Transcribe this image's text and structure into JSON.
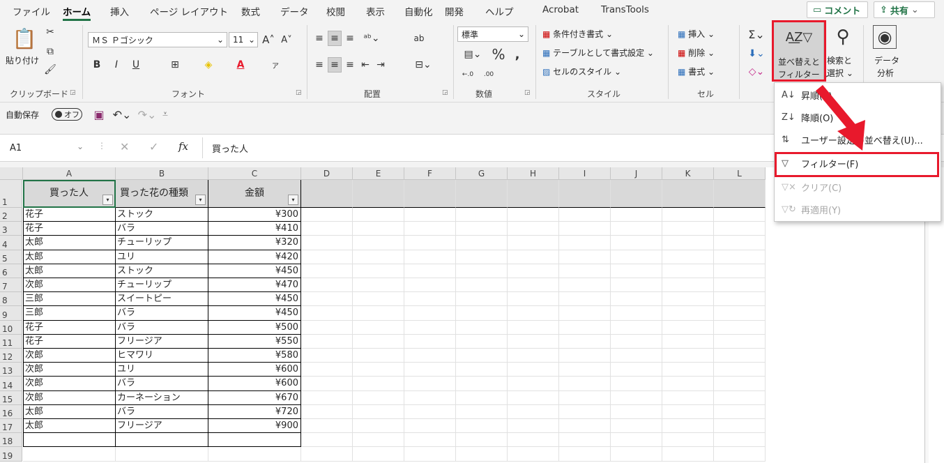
{
  "menu": {
    "tabs": [
      "ファイル",
      "ホーム",
      "挿入",
      "ページ レイアウト",
      "数式",
      "データ",
      "校閲",
      "表示",
      "自動化",
      "開発",
      "ヘルプ",
      "Acrobat",
      "TransTools"
    ],
    "active": "ホーム",
    "comment": "コメント",
    "share": "共有"
  },
  "ribbon": {
    "clipboard": {
      "paste": "貼り付け",
      "label": "クリップボード"
    },
    "font": {
      "name": "ＭＳ Ｐゴシック",
      "size": "11",
      "bold": "B",
      "italic": "I",
      "underline": "U",
      "label": "フォント"
    },
    "alignment": {
      "label": "配置"
    },
    "number": {
      "format": "標準",
      "percent": "%",
      "label": "数値"
    },
    "styles": {
      "conditional": "条件付き書式",
      "table": "テーブルとして書式設定",
      "cell": "セルのスタイル",
      "label": "スタイル"
    },
    "cells": {
      "insert": "挿入",
      "delete": "削除",
      "format": "書式",
      "label": "セル"
    },
    "editing": {
      "sort_filter_1": "並べ替えと",
      "sort_filter_2": "フィルター",
      "find_1": "検索と",
      "find_2": "選択"
    },
    "analysis": {
      "l1": "データ",
      "l2": "分析"
    }
  },
  "qat": {
    "autosave": "自動保存",
    "toggle": "オフ"
  },
  "formula_bar": {
    "namebox": "A1",
    "fx": "fx",
    "content": "買った人"
  },
  "columns": [
    "A",
    "B",
    "C",
    "D",
    "E",
    "F",
    "G",
    "H",
    "I",
    "J",
    "K",
    "L"
  ],
  "rows": [
    "1",
    "2",
    "3",
    "4",
    "5",
    "6",
    "7",
    "8",
    "9",
    "10",
    "11",
    "12",
    "13",
    "14",
    "15",
    "16",
    "17",
    "18",
    "19"
  ],
  "table": {
    "headers": [
      "買った人",
      "買った花の種類",
      "金額"
    ],
    "data": [
      [
        "花子",
        "ストック",
        "¥300"
      ],
      [
        "花子",
        "バラ",
        "¥410"
      ],
      [
        "太郎",
        "チューリップ",
        "¥320"
      ],
      [
        "太郎",
        "ユリ",
        "¥420"
      ],
      [
        "太郎",
        "ストック",
        "¥450"
      ],
      [
        "次郎",
        "チューリップ",
        "¥470"
      ],
      [
        "三郎",
        "スイートピー",
        "¥450"
      ],
      [
        "三郎",
        "バラ",
        "¥450"
      ],
      [
        "花子",
        "バラ",
        "¥500"
      ],
      [
        "花子",
        "フリージア",
        "¥550"
      ],
      [
        "次郎",
        "ヒマワリ",
        "¥580"
      ],
      [
        "次郎",
        "ユリ",
        "¥600"
      ],
      [
        "次郎",
        "バラ",
        "¥600"
      ],
      [
        "次郎",
        "カーネーション",
        "¥670"
      ],
      [
        "太郎",
        "バラ",
        "¥720"
      ],
      [
        "太郎",
        "フリージア",
        "¥900"
      ]
    ]
  },
  "dropdown": {
    "items": [
      {
        "label": "昇順(S)",
        "icon": "sort-ascending-icon",
        "disabled": false
      },
      {
        "label": "降順(O)",
        "icon": "sort-descending-icon",
        "disabled": false
      },
      {
        "label": "ユーザー設定の並べ替え(U)...",
        "icon": "custom-sort-icon",
        "disabled": false
      },
      {
        "label": "フィルター(F)",
        "icon": "filter-icon",
        "disabled": false
      },
      {
        "label": "クリア(C)",
        "icon": "clear-filter-icon",
        "disabled": true
      },
      {
        "label": "再適用(Y)",
        "icon": "reapply-icon",
        "disabled": true
      }
    ]
  },
  "colors": {
    "highlight": "#e8192c",
    "excel_green": "#217346",
    "header_fill": "#d9d9d9"
  }
}
